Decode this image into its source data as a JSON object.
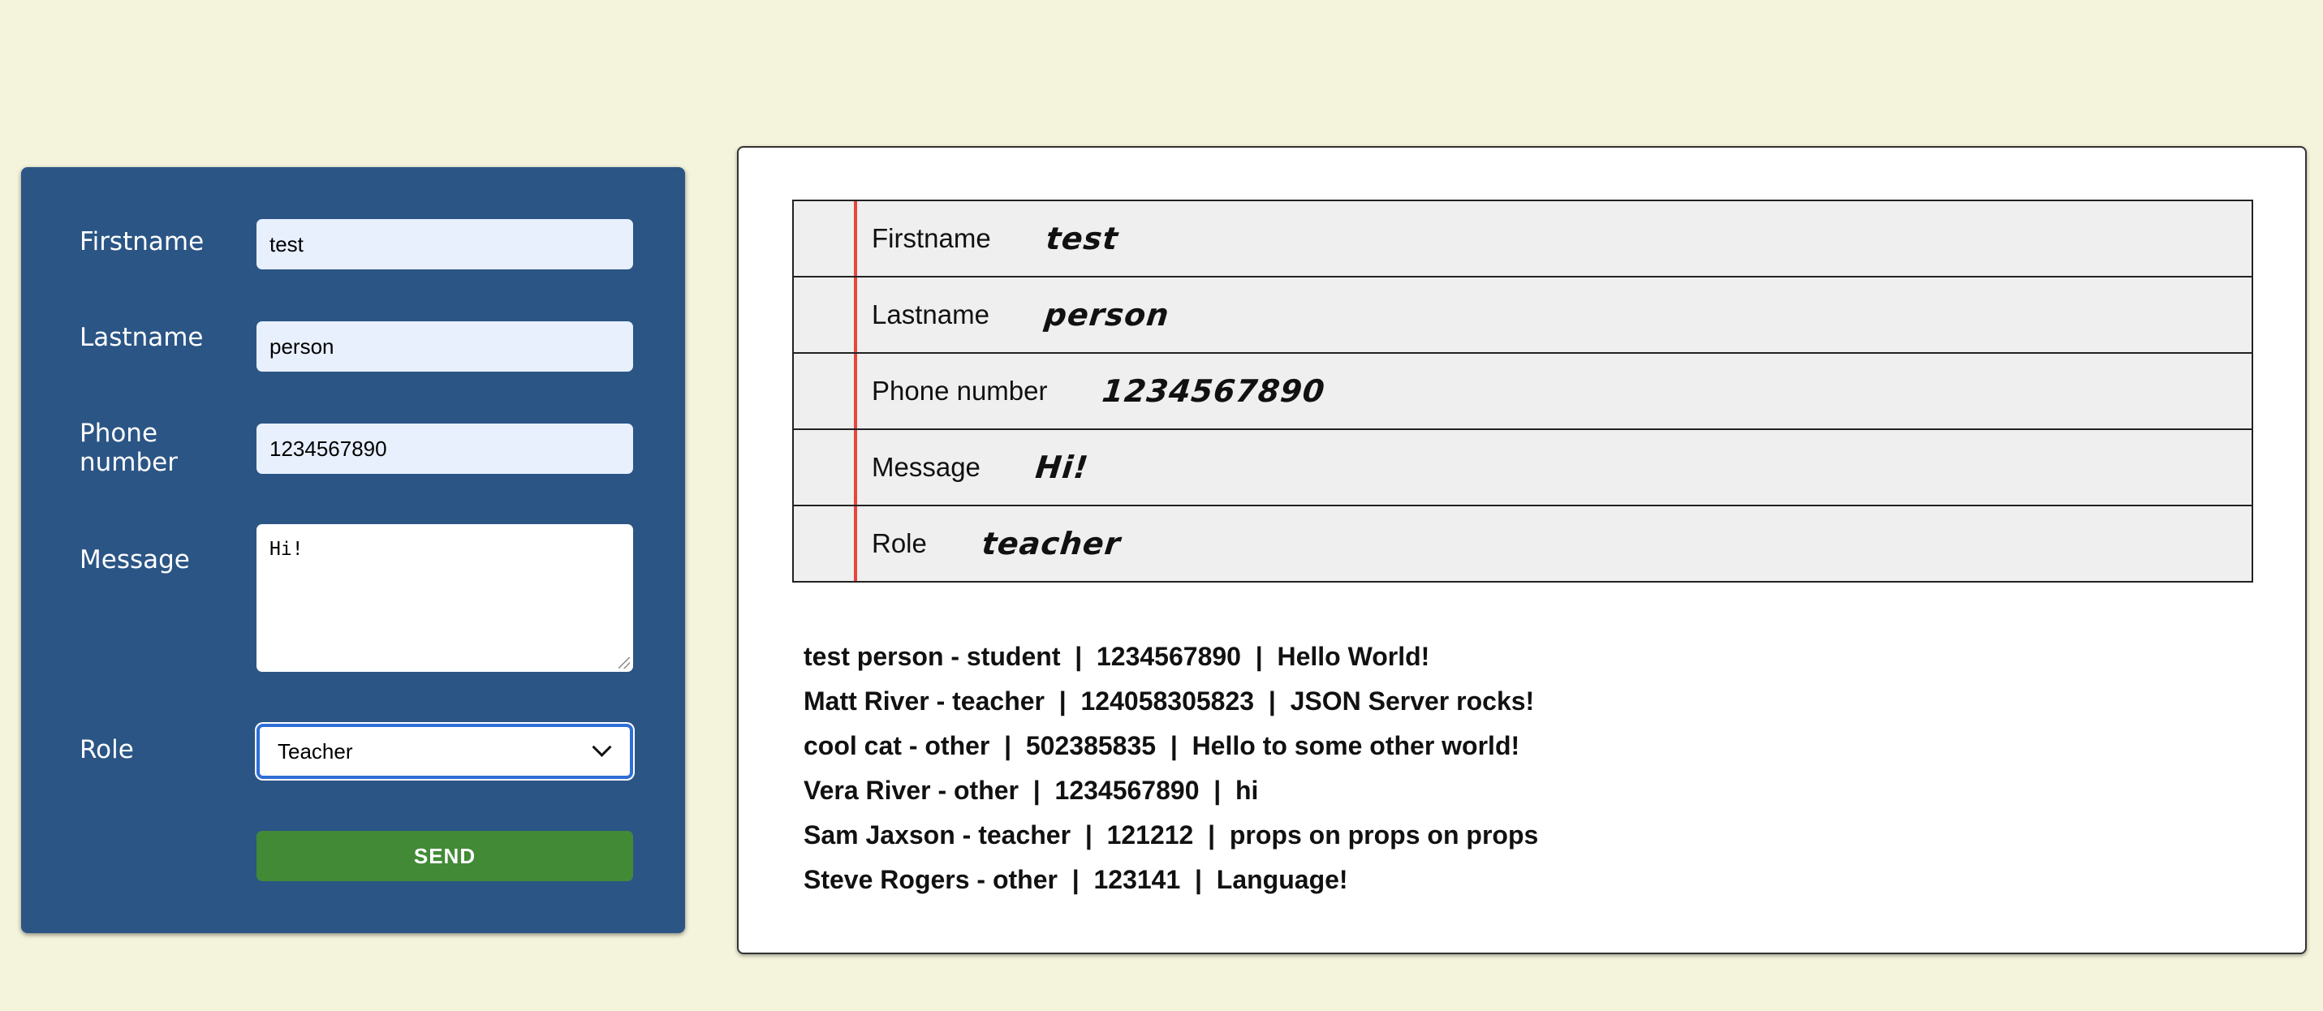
{
  "form": {
    "firstname": {
      "label": "Firstname",
      "value": "test"
    },
    "lastname": {
      "label": "Lastname",
      "value": "person"
    },
    "phone": {
      "label": "Phone number",
      "value": "1234567890"
    },
    "message": {
      "label": "Message",
      "value": "Hi!"
    },
    "role": {
      "label": "Role",
      "value": "Teacher"
    },
    "send_label": "SEND"
  },
  "preview": {
    "rows": [
      {
        "label": "Firstname",
        "value": "test"
      },
      {
        "label": "Lastname",
        "value": "person"
      },
      {
        "label": "Phone number",
        "value": "1234567890"
      },
      {
        "label": "Message",
        "value": "Hi!"
      },
      {
        "label": "Role",
        "value": "teacher"
      }
    ]
  },
  "entries": [
    "test person - student  |  1234567890  |  Hello World!",
    "Matt River - teacher  |  124058305823  |  JSON Server rocks!",
    "cool cat - other  |  502385835  |  Hello to some other world!",
    "Vera River - other  |  1234567890  |  hi",
    "Sam Jaxson - teacher  |  121212  |  props on props on props",
    "Steve Rogers - other  |  123141  |  Language!"
  ],
  "colors": {
    "page_background": "#f4f4dc",
    "form_panel": "#2b5585",
    "send_button": "#428a36",
    "margin_line": "#e8453c"
  }
}
